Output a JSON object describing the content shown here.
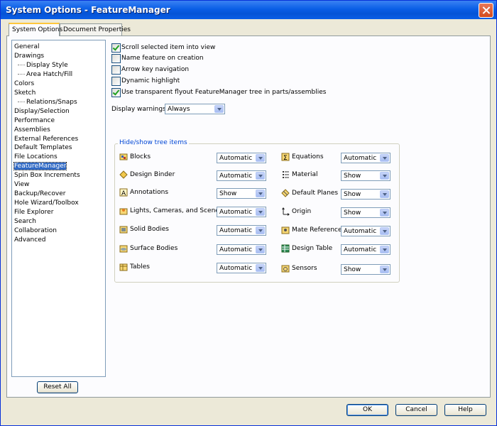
{
  "window": {
    "title": "System Options - FeatureManager"
  },
  "tabs": [
    {
      "label": "System Options",
      "active": true
    },
    {
      "label": "Document Properties",
      "active": false
    }
  ],
  "categories": [
    {
      "label": "General"
    },
    {
      "label": "Drawings"
    },
    {
      "label": "Display Style",
      "sub": true
    },
    {
      "label": "Area Hatch/Fill",
      "sub": true
    },
    {
      "label": "Colors"
    },
    {
      "label": "Sketch"
    },
    {
      "label": "Relations/Snaps",
      "sub": true
    },
    {
      "label": "Display/Selection"
    },
    {
      "label": "Performance"
    },
    {
      "label": "Assemblies"
    },
    {
      "label": "External References"
    },
    {
      "label": "Default Templates"
    },
    {
      "label": "File Locations"
    },
    {
      "label": "FeatureManager",
      "selected": true
    },
    {
      "label": "Spin Box Increments"
    },
    {
      "label": "View"
    },
    {
      "label": "Backup/Recover"
    },
    {
      "label": "Hole Wizard/Toolbox"
    },
    {
      "label": "File Explorer"
    },
    {
      "label": "Search"
    },
    {
      "label": "Collaboration"
    },
    {
      "label": "Advanced"
    }
  ],
  "reset_all": {
    "label": "Reset All"
  },
  "options": [
    {
      "label": "Scroll selected item into view",
      "checked": true
    },
    {
      "label": "Name feature on creation",
      "checked": false
    },
    {
      "label": "Arrow key navigation",
      "checked": false
    },
    {
      "label": "Dynamic highlight",
      "checked": false
    },
    {
      "label": "Use transparent flyout FeatureManager tree in parts/assemblies",
      "checked": true
    }
  ],
  "display_warnings": {
    "label": "Display warnings:",
    "value": "Always"
  },
  "tree_items": {
    "title": "Hide/show tree items",
    "left": [
      {
        "name": "Blocks",
        "value": "Automatic",
        "icon": "blocks-icon"
      },
      {
        "name": "Design Binder",
        "value": "Automatic",
        "icon": "design-binder-icon"
      },
      {
        "name": "Annotations",
        "value": "Show",
        "icon": "annotations-icon"
      },
      {
        "name": "Lights, Cameras, and Scene",
        "value": "Automatic",
        "icon": "lights-cameras-icon"
      },
      {
        "name": "Solid Bodies",
        "value": "Automatic",
        "icon": "solid-bodies-icon"
      },
      {
        "name": "Surface Bodies",
        "value": "Automatic",
        "icon": "surface-bodies-icon"
      },
      {
        "name": "Tables",
        "value": "Automatic",
        "icon": "tables-icon"
      }
    ],
    "right": [
      {
        "name": "Equations",
        "value": "Automatic",
        "icon": "equations-icon"
      },
      {
        "name": "Material",
        "value": "Show",
        "icon": "material-icon"
      },
      {
        "name": "Default Planes",
        "value": "Show",
        "icon": "default-planes-icon"
      },
      {
        "name": "Origin",
        "value": "Show",
        "icon": "origin-icon"
      },
      {
        "name": "Mate References",
        "value": "Automatic",
        "icon": "mate-references-icon"
      },
      {
        "name": "Design Table",
        "value": "Automatic",
        "icon": "design-table-icon"
      },
      {
        "name": "Sensors",
        "value": "Show",
        "icon": "sensors-icon"
      }
    ]
  },
  "buttons": {
    "ok": "OK",
    "cancel": "Cancel",
    "help": "Help"
  }
}
